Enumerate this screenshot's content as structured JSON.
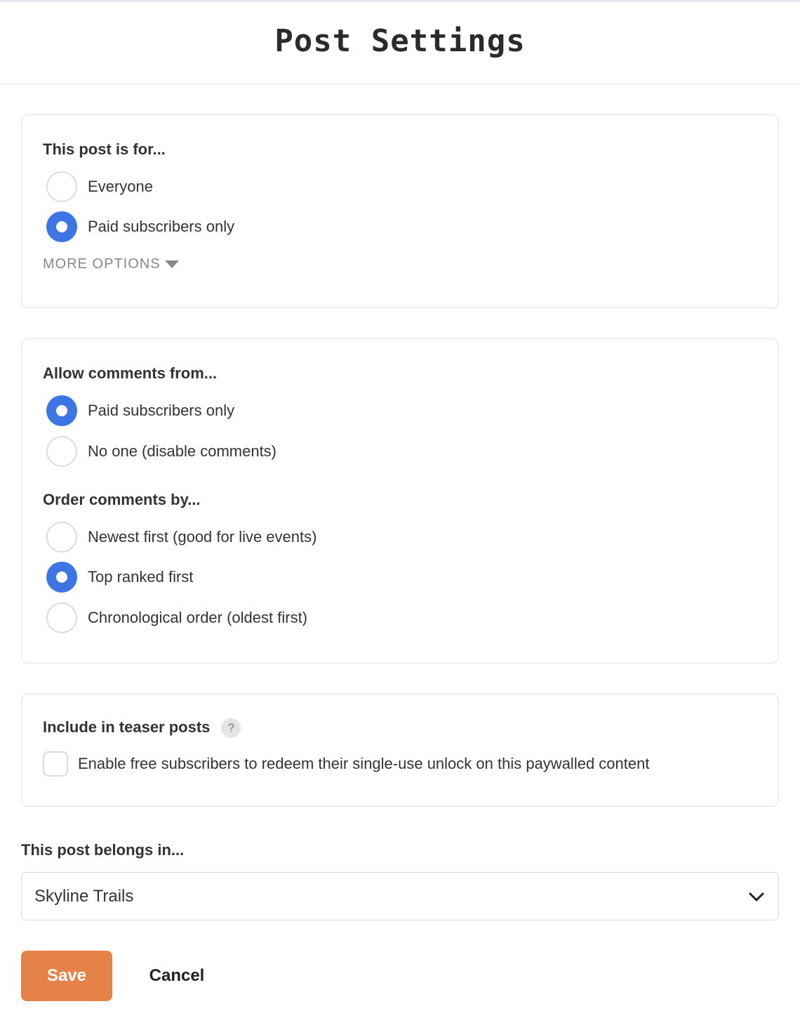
{
  "header": {
    "title": "Post Settings"
  },
  "audience": {
    "title": "This post is for...",
    "options": [
      {
        "label": "Everyone",
        "checked": false
      },
      {
        "label": "Paid subscribers only",
        "checked": true
      }
    ],
    "more_options": "MORE OPTIONS"
  },
  "comments": {
    "allow_title": "Allow comments from...",
    "allow_options": [
      {
        "label": "Paid subscribers only",
        "checked": true
      },
      {
        "label": "No one (disable comments)",
        "checked": false
      }
    ],
    "order_title": "Order comments by...",
    "order_options": [
      {
        "label": "Newest first (good for live events)",
        "checked": false
      },
      {
        "label": "Top ranked first",
        "checked": true
      },
      {
        "label": "Chronological order (oldest first)",
        "checked": false
      }
    ]
  },
  "teaser": {
    "title": "Include in teaser posts",
    "help": "?",
    "checkbox_label": "Enable free subscribers to redeem their single-use unlock on this paywalled content",
    "checked": false
  },
  "section": {
    "label": "This post belongs in...",
    "selected": "Skyline Trails"
  },
  "actions": {
    "save": "Save",
    "cancel": "Cancel"
  },
  "colors": {
    "accent": "#3d75e4",
    "save": "#e4824a"
  }
}
